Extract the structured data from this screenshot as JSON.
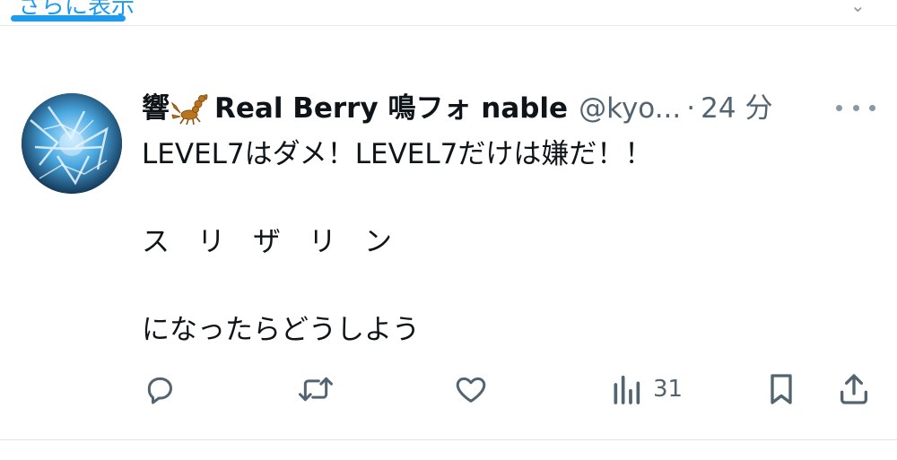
{
  "previous_row": {
    "link_text": "さらに表示",
    "chevron_icon": "chevron-down-icon"
  },
  "tweet": {
    "avatar_icon": "avatar-image",
    "display_name_prefix": "響",
    "display_name_emoji": "scorpion-emoji",
    "display_name_rest": "Real Berry 鳴フォ nable",
    "handle": "@kyo...",
    "separator": "·",
    "time": "24 分",
    "more_icon": "more-dots-icon",
    "lines": [
      "LEVEL7はダメ！LEVEL7だけは嫌だ！！",
      "ス　リ　ザ　リ　ン",
      "になったらどうしよう"
    ]
  },
  "actions": {
    "reply_icon": "reply-icon",
    "retweet_icon": "retweet-icon",
    "like_icon": "heart-icon",
    "views_icon": "views-icon",
    "views_count": "31",
    "bookmark_icon": "bookmark-icon",
    "share_icon": "share-icon"
  },
  "colors": {
    "accent": "#1d9bf0",
    "text_primary": "#0f1419",
    "text_secondary": "#536471",
    "icon_gray": "#536471",
    "divider": "#e6e9ec"
  }
}
